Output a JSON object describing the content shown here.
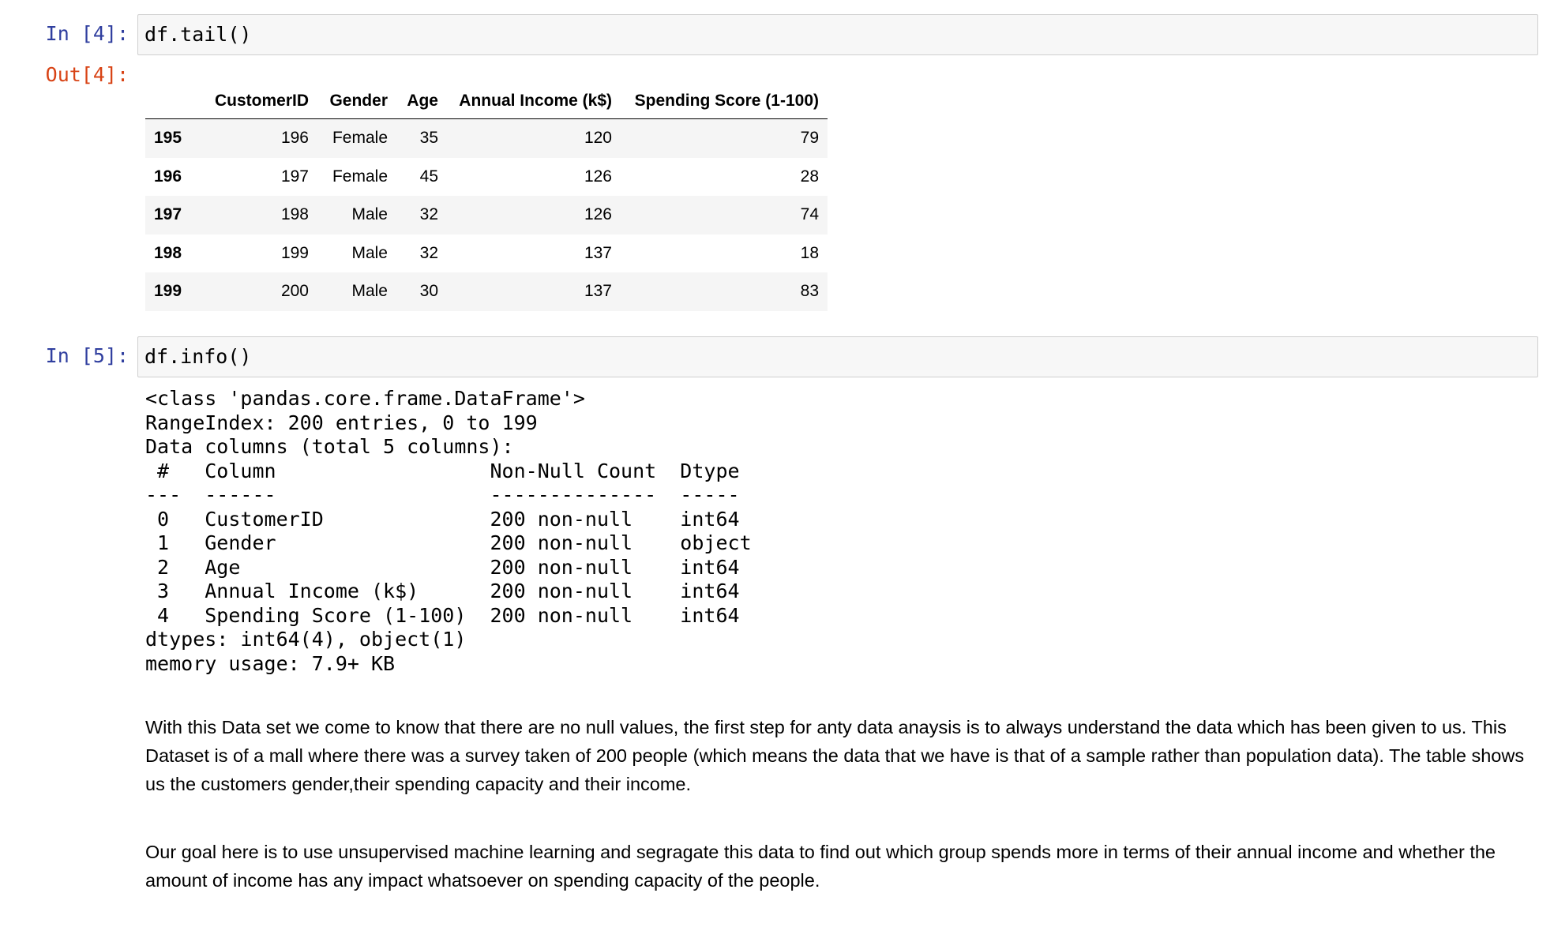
{
  "cells": {
    "cell4": {
      "in_prompt": "In [4]:",
      "code": "df.tail()",
      "out_prompt": "Out[4]:",
      "table": {
        "index_header": "",
        "columns": [
          "CustomerID",
          "Gender",
          "Age",
          "Annual Income (k$)",
          "Spending Score (1-100)"
        ],
        "rows": [
          {
            "index": "195",
            "values": [
              "196",
              "Female",
              "35",
              "120",
              "79"
            ]
          },
          {
            "index": "196",
            "values": [
              "197",
              "Female",
              "45",
              "126",
              "28"
            ]
          },
          {
            "index": "197",
            "values": [
              "198",
              "Male",
              "32",
              "126",
              "74"
            ]
          },
          {
            "index": "198",
            "values": [
              "199",
              "Male",
              "32",
              "137",
              "18"
            ]
          },
          {
            "index": "199",
            "values": [
              "200",
              "Male",
              "30",
              "137",
              "83"
            ]
          }
        ]
      }
    },
    "cell5": {
      "in_prompt": "In [5]:",
      "code": "df.info()",
      "stdout_lines": [
        "<class 'pandas.core.frame.DataFrame'>",
        "RangeIndex: 200 entries, 0 to 199",
        "Data columns (total 5 columns):",
        " #   Column                  Non-Null Count  Dtype ",
        "---  ------                  --------------  ----- ",
        " 0   CustomerID              200 non-null    int64 ",
        " 1   Gender                  200 non-null    object",
        " 2   Age                     200 non-null    int64 ",
        " 3   Annual Income (k$)      200 non-null    int64 ",
        " 4   Spending Score (1-100)  200 non-null    int64 ",
        "dtypes: int64(4), object(1)",
        "memory usage: 7.9+ KB"
      ]
    },
    "markdown": {
      "paragraph1": "With this Data set we come to know that there are no null values, the first step for anty data anaysis is to always understand the data which has been given to us. This Dataset is of a mall where there was a survey taken of 200 people (which means the data that we have is that of a sample rather than population data). The table shows us the customers gender,their spending capacity and their income.",
      "paragraph2": "Our goal here is to use unsupervised machine learning and segragate this data to find out which group spends more in terms of their annual income and whether the amount of income has any impact whatsoever on spending capacity of the people."
    }
  }
}
